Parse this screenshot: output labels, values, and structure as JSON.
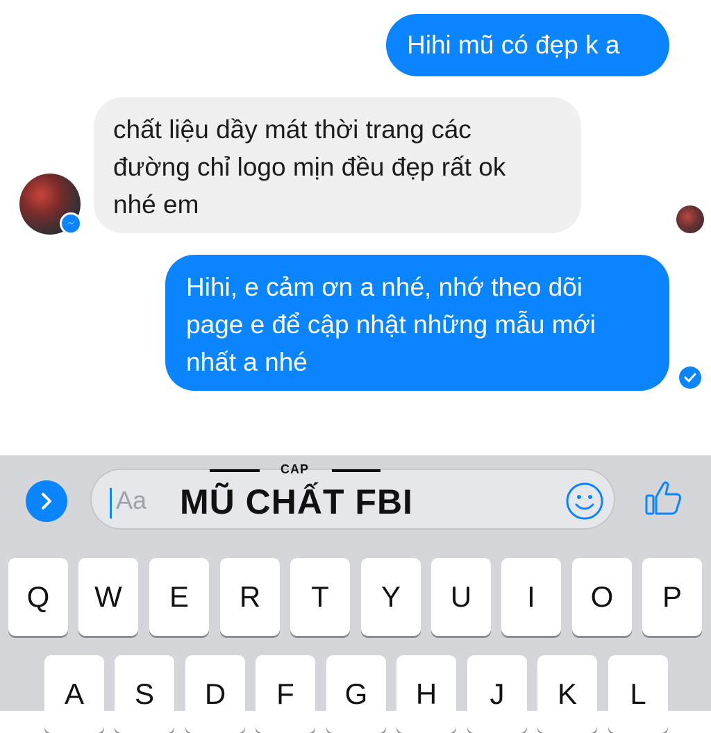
{
  "messages": [
    {
      "direction": "outgoing",
      "text": "Hihi mũ có đẹp k a"
    },
    {
      "direction": "incoming",
      "lines": [
        "chất liệu dầy mát thời trang các",
        "đường chỉ logo mịn đều đẹp rất ok",
        "nhé em"
      ]
    },
    {
      "direction": "outgoing",
      "lines": [
        "Hihi, e cảm ơn a nhé, nhớ theo dõi",
        "page e để cập nhật những mẫu mới",
        "nhất a nhé"
      ]
    }
  ],
  "composer": {
    "placeholder": "Aa",
    "expand_icon": "chevron-right-icon",
    "emoji_icon": "smiley-icon",
    "like_icon": "thumbs-up-icon"
  },
  "overlay": {
    "small": "CAP",
    "title": "MŨ CHẤT FBI"
  },
  "keyboard": {
    "row1": [
      "Q",
      "W",
      "E",
      "R",
      "T",
      "Y",
      "U",
      "I",
      "O",
      "P"
    ],
    "row2": [
      "A",
      "S",
      "D",
      "F",
      "G",
      "H",
      "J",
      "K",
      "L"
    ]
  },
  "colors": {
    "accent": "#0a84ff",
    "incoming_bubble": "#f1f0f0",
    "keyboard_bg": "#d4d6da"
  }
}
